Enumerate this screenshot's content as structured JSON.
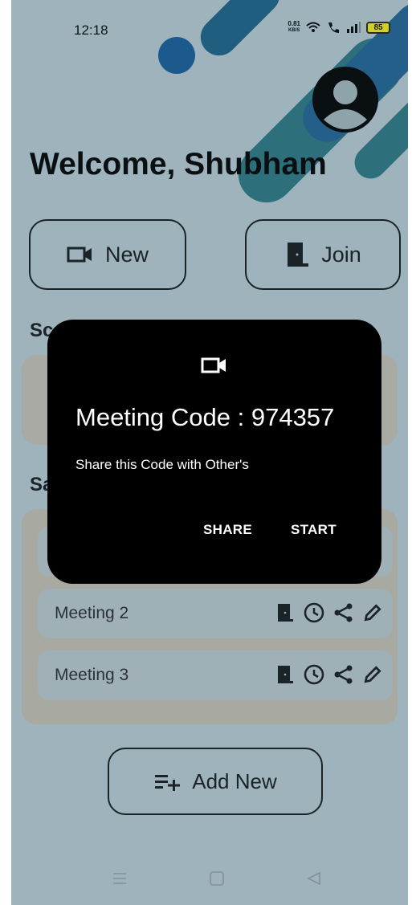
{
  "status_bar": {
    "time": "12:18",
    "net_speed_value": "0.81",
    "net_speed_unit": "KB/S",
    "battery": "85",
    "icons": [
      "wifi-icon",
      "volte-call-icon",
      "signal-icon",
      "battery-icon"
    ]
  },
  "header": {
    "welcome": "Welcome, Shubham",
    "avatar_icon": "account-icon"
  },
  "actions": {
    "new_label": "New",
    "join_label": "Join"
  },
  "sections": {
    "scheduled_partial": "Sc",
    "saved_partial": "Sa"
  },
  "meetings": [
    {
      "label": "Meeting 2"
    },
    {
      "label": "Meeting 3"
    }
  ],
  "add_new_label": "Add New",
  "dialog": {
    "code_text": "Meeting Code : 974357",
    "message": "Share this Code with Other's",
    "share_label": "SHARE",
    "start_label": "START"
  },
  "colors": {
    "background": "#9fb3bd",
    "dialog": "#000000",
    "accent_teal": "#2d6f7a",
    "accent_blue": "#1c5a8e",
    "battery": "#cfd02a"
  }
}
